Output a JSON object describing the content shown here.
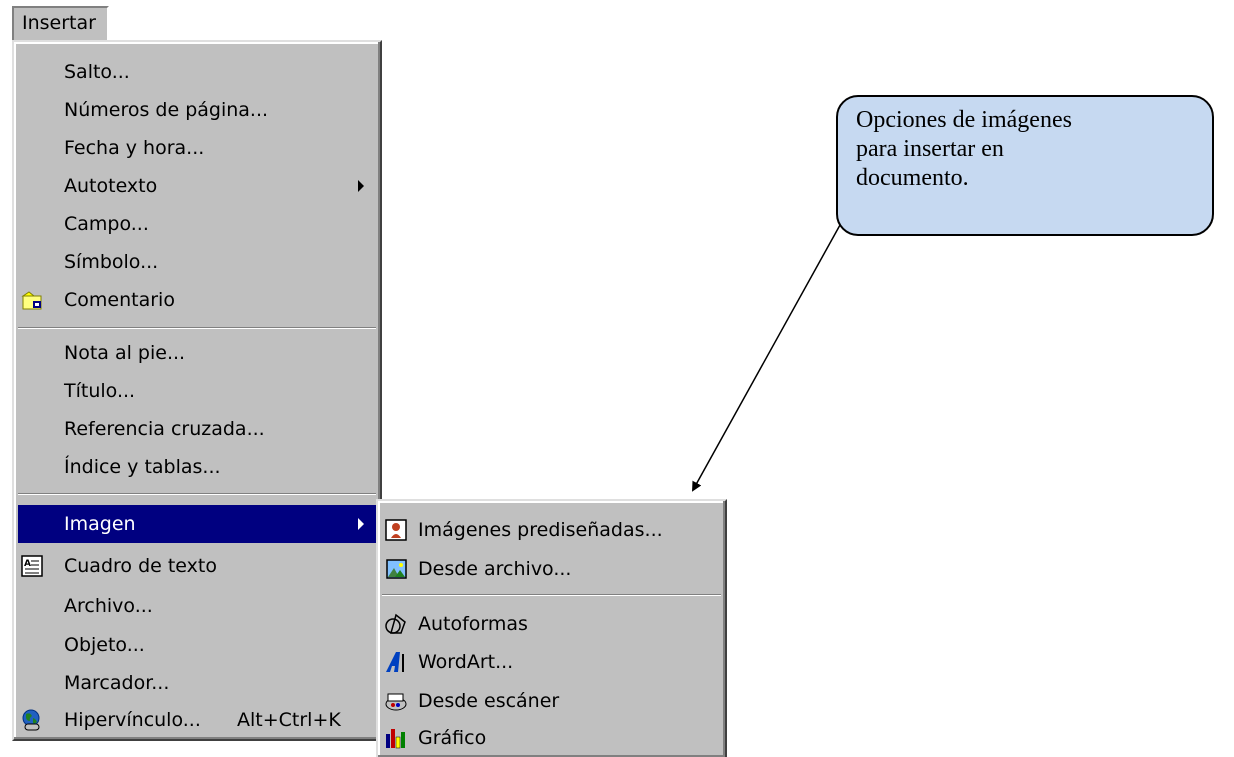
{
  "menubar": {
    "insert_label": "Insertar"
  },
  "menu": {
    "items": [
      {
        "label": "Salto..."
      },
      {
        "label": "Números de página..."
      },
      {
        "label": "Fecha y hora..."
      },
      {
        "label": "Autotexto"
      },
      {
        "label": "Campo..."
      },
      {
        "label": "Símbolo..."
      },
      {
        "label": "Comentario"
      },
      {
        "label": "Nota al pie..."
      },
      {
        "label": "Título..."
      },
      {
        "label": "Referencia cruzada..."
      },
      {
        "label": "Índice y tablas..."
      },
      {
        "label": "Imagen"
      },
      {
        "label": "Cuadro de texto"
      },
      {
        "label": "Archivo..."
      },
      {
        "label": "Objeto..."
      },
      {
        "label": "Marcador..."
      },
      {
        "label": "Hipervínculo...",
        "shortcut": "Alt+Ctrl+K"
      }
    ]
  },
  "submenu": {
    "items": [
      {
        "label": "Imágenes prediseñadas..."
      },
      {
        "label": "Desde archivo..."
      },
      {
        "label": "Autoformas"
      },
      {
        "label": "WordArt..."
      },
      {
        "label": "Desde escáner"
      },
      {
        "label": "Gráfico"
      }
    ]
  },
  "callout": {
    "lines": [
      "Opciones de imágenes",
      "para insertar en",
      "documento."
    ]
  },
  "colors": {
    "menu_bg": "#c0c0c0",
    "highlight": "#000080",
    "callout_bg": "#c6d9f1"
  }
}
